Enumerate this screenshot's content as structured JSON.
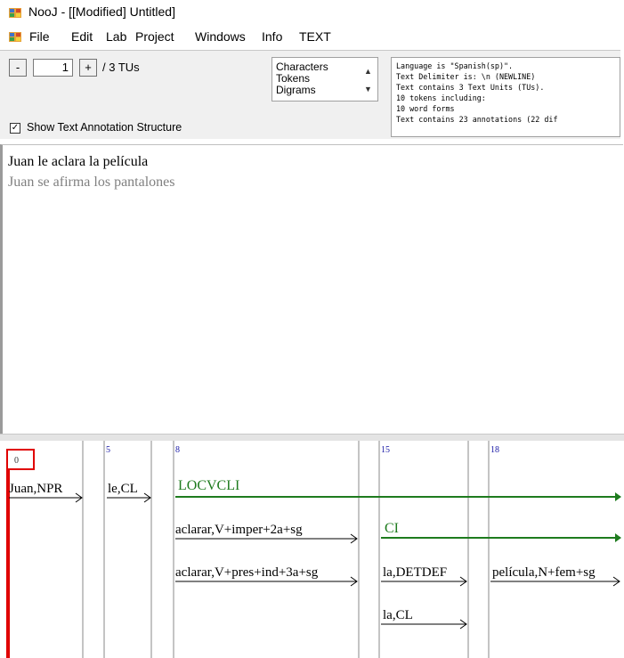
{
  "window": {
    "title": "NooJ - [[Modified] Untitled]"
  },
  "menu": [
    "File",
    "Edit",
    "Lab",
    "Project",
    "Windows",
    "Info",
    "TEXT"
  ],
  "toolbar": {
    "minus_label": "-",
    "plus_label": "+",
    "tu_value": "1",
    "tu_total": "/ 3 TUs",
    "list_options": [
      "Characters",
      "Tokens",
      "Digrams"
    ],
    "show_annotation_label": "Show Text Annotation Structure",
    "show_annotation_checked": true
  },
  "info_lines": [
    "Language is \"Spanish(sp)\".",
    "Text Delimiter is: \\n (NEWLINE)",
    "Text contains 3 Text Units (TUs).",
    "10 tokens including:",
    "10 word forms",
    "Text contains 23 annotations (22 dif"
  ],
  "text_lines": [
    "Juan le aclara la película",
    "Juan se afirma los pantalones"
  ],
  "annotation": {
    "positions": [
      "0",
      "5",
      "8",
      "15",
      "18"
    ],
    "labels": {
      "juan": "Juan,NPR",
      "le": "le,CL",
      "locvcli": "LOCVCLI",
      "aclarar_imper": "aclarar,V+imper+2a+sg",
      "ci": "CI",
      "aclarar_pres": "aclarar,V+pres+ind+3a+sg",
      "la_det": "la,DETDEF",
      "pelicula": "película,N+fem+sg",
      "la_cl": "la,CL"
    },
    "colors": {
      "green": "#1e7b1e",
      "red": "#e00000",
      "blue": "#1a1aa6"
    }
  }
}
